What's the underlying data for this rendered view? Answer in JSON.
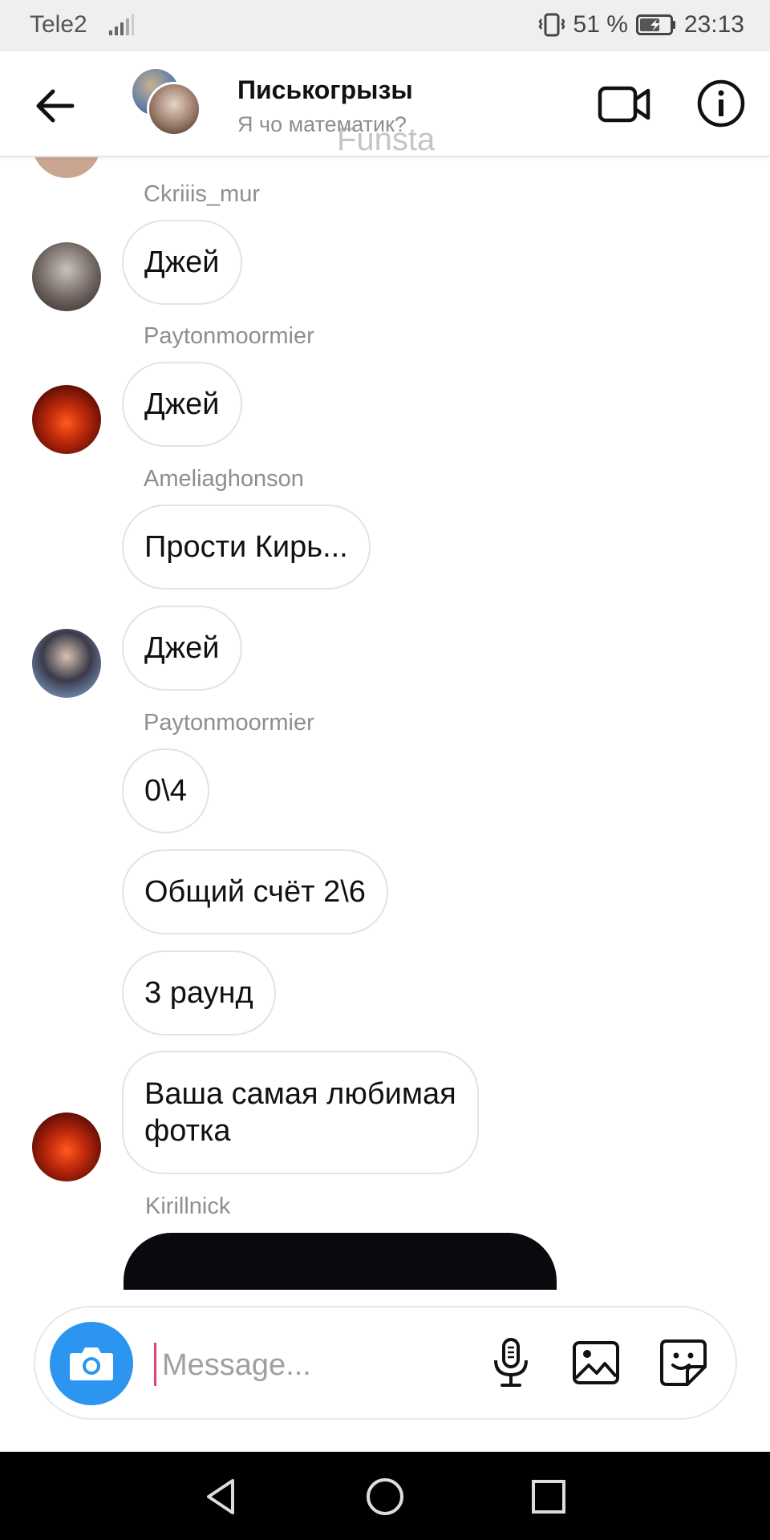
{
  "status_bar": {
    "carrier": "Tele2",
    "battery": "51 %",
    "time": "23:13"
  },
  "header": {
    "title": "Писькогрызы",
    "subtitle": "Я чо математик?",
    "watermark": "Funsta"
  },
  "messages": {
    "s1": "Ckriiis_mur",
    "m1": "Джей",
    "s2": "Paytonmoormier",
    "m2": "Джей",
    "s3": "Ameliaghonson",
    "m3": "Прости Кирь...",
    "m4": "Джей",
    "s4": "Paytonmoormier",
    "m5": "0\\4",
    "m6": "Общий счёт 2\\6",
    "m7": "3 раунд",
    "m8_line1": "Ваша самая любимая",
    "m8_line2": "фотка",
    "s5": "Kirillnick"
  },
  "composer": {
    "placeholder": "Message..."
  },
  "icons": {
    "back": "arrow-left",
    "video": "video-camera",
    "info": "info-circle",
    "camera": "camera",
    "mic": "microphone",
    "gallery": "image",
    "sticker": "sticker"
  },
  "colors": {
    "accent": "#2b95ef",
    "caret": "#e0427a",
    "secondary_text": "#8e8e8e"
  }
}
